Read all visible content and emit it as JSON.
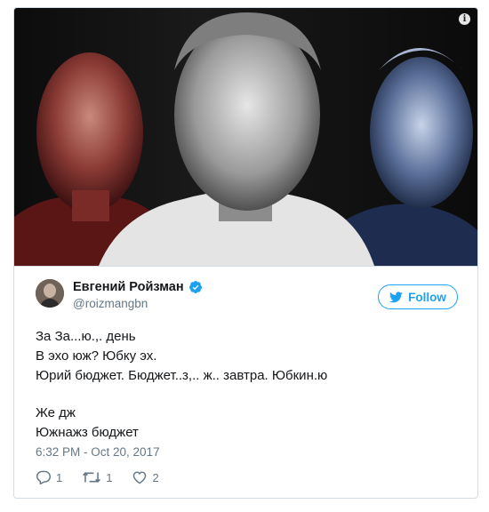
{
  "tweet": {
    "author_name": "Евгений Ройзман",
    "author_handle": "@roizmangbn",
    "follow_label": "Follow",
    "lines": [
      "За За...ю.,. день",
      "В эхо юж? Юбку эх.",
      "Юрий бюджет. Бюджет..з,.. ж.. завтра. Юбкин.ю",
      "",
      "Же дж",
      "Южнажз бюджет"
    ],
    "timestamp": "6:32 PM - Oct 20, 2017",
    "replies": "1",
    "retweets": "1",
    "likes": "2"
  },
  "icons": {
    "media": "info-icon",
    "verified": "verified-badge-icon",
    "follow": "twitter-bird-icon",
    "reply": "reply-icon",
    "retweet": "retweet-icon",
    "like": "heart-icon"
  },
  "colors": {
    "accent": "#1da1f2",
    "text": "#14171a",
    "secondary": "#657786",
    "border": "#d4dde3"
  }
}
